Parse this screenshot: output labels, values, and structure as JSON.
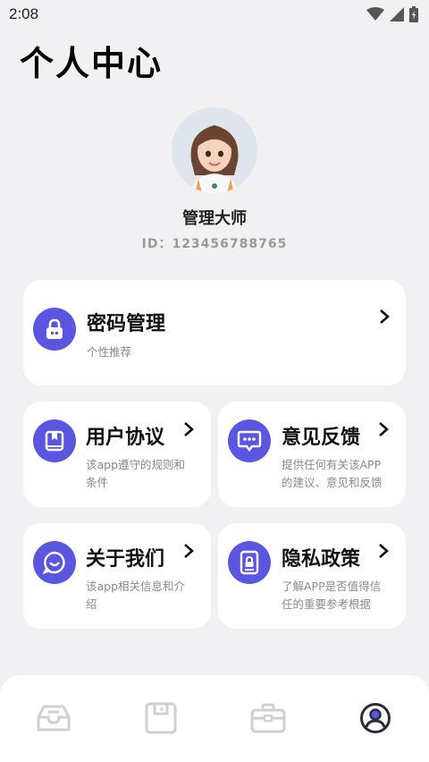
{
  "status_bar": {
    "time": "2:08"
  },
  "page": {
    "title": "个人中心"
  },
  "profile": {
    "name": "管理大师",
    "id_text": "ID：123456788765"
  },
  "menu": {
    "password": {
      "title": "密码管理",
      "desc": "个性推荐"
    },
    "agreement": {
      "title": "用户协议",
      "desc_line1": "该app遵守的规则和",
      "desc_line2": "条件"
    },
    "feedback": {
      "title": "意见反馈",
      "desc_line1": "提供任何有关该APP",
      "desc_line2": "的建议、意见和反馈"
    },
    "about": {
      "title": "关于我们",
      "desc_line1": "该app相关信息和介",
      "desc_line2": "绍"
    },
    "privacy": {
      "title": "隐私政策",
      "desc_line1": "了解APP是否值得信",
      "desc_line2": "任的重要参考根据"
    }
  },
  "tabbar": {
    "items": [
      {
        "icon": "inbox-icon",
        "active": false
      },
      {
        "icon": "save-icon",
        "active": false
      },
      {
        "icon": "briefcase-icon",
        "active": false
      },
      {
        "icon": "user-circle-icon",
        "active": true
      }
    ]
  },
  "colors": {
    "accent": "#5b56e0",
    "background": "#f1f1f3",
    "card": "#ffffff",
    "inactive_icon": "#cfcfd4"
  }
}
